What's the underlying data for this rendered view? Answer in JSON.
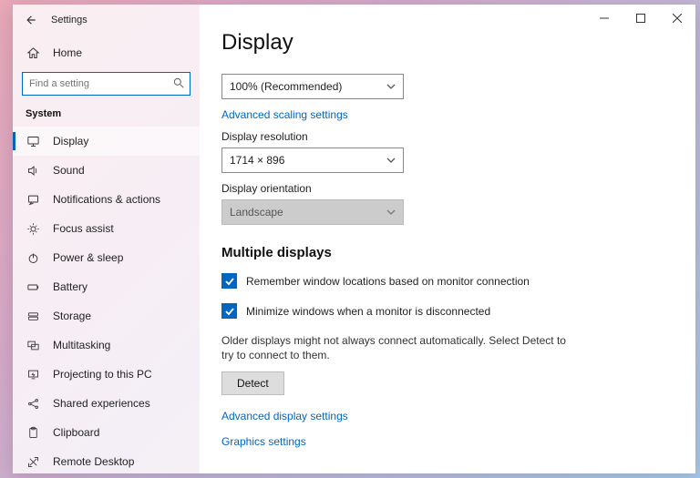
{
  "app_title": "Settings",
  "home_label": "Home",
  "search": {
    "placeholder": "Find a setting"
  },
  "section_label": "System",
  "nav": [
    {
      "label": "Display"
    },
    {
      "label": "Sound"
    },
    {
      "label": "Notifications & actions"
    },
    {
      "label": "Focus assist"
    },
    {
      "label": "Power & sleep"
    },
    {
      "label": "Battery"
    },
    {
      "label": "Storage"
    },
    {
      "label": "Multitasking"
    },
    {
      "label": "Projecting to this PC"
    },
    {
      "label": "Shared experiences"
    },
    {
      "label": "Clipboard"
    },
    {
      "label": "Remote Desktop"
    }
  ],
  "page": {
    "title": "Display",
    "scale_value": "100% (Recommended)",
    "scaling_link": "Advanced scaling settings",
    "res_label": "Display resolution",
    "res_value": "1714 × 896",
    "orient_label": "Display orientation",
    "orient_value": "Landscape",
    "multi_h": "Multiple displays",
    "check1": "Remember window locations based on monitor connection",
    "check2": "Minimize windows when a monitor is disconnected",
    "detect_info": "Older displays might not always connect automatically. Select Detect to try to connect to them.",
    "detect_btn": "Detect",
    "adv_link": "Advanced display settings",
    "gfx_link": "Graphics settings"
  }
}
